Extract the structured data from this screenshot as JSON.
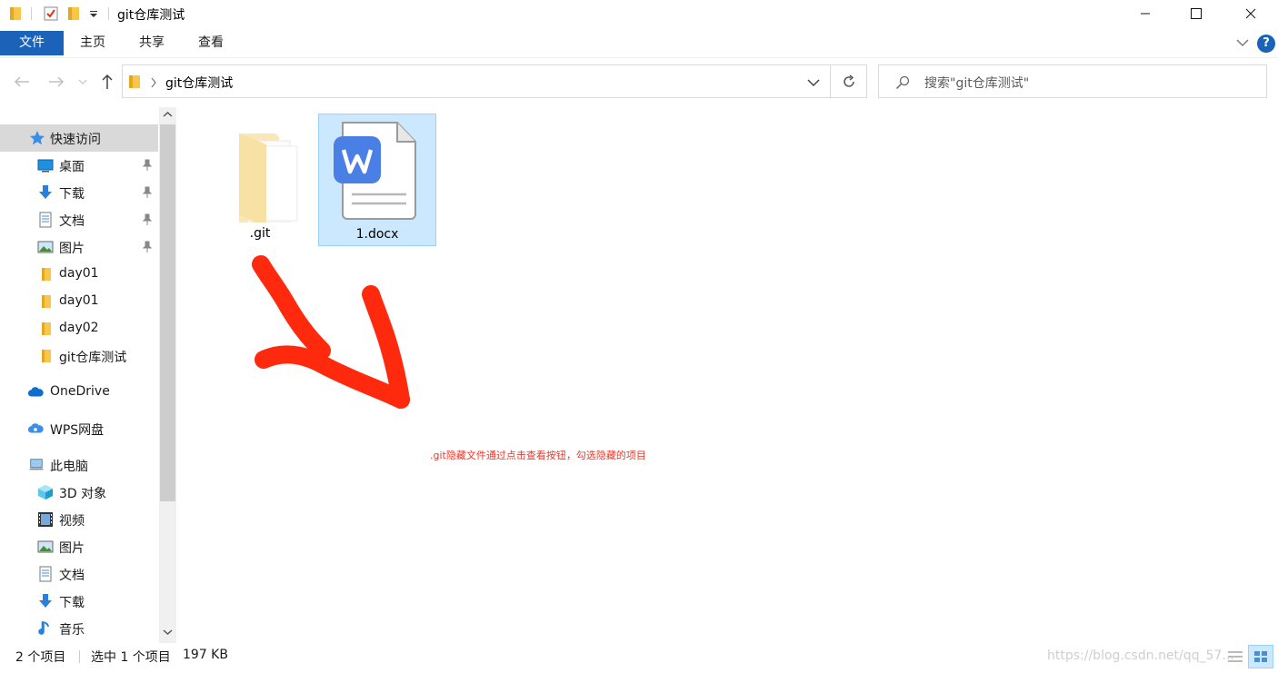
{
  "window": {
    "title": "git仓库测试",
    "controls": [
      "minimize-icon",
      "maximize-icon",
      "close-icon"
    ]
  },
  "ribbon": {
    "tabs": [
      {
        "label": "文件",
        "active": true
      },
      {
        "label": "主页"
      },
      {
        "label": "共享"
      },
      {
        "label": "查看"
      }
    ],
    "help_label": "?"
  },
  "address": {
    "path": "git仓库测试",
    "search_placeholder": "搜索\"git仓库测试\""
  },
  "sidebar": {
    "items": [
      {
        "label": "快速访问",
        "icon": "star-icon",
        "selected": true,
        "pinned": false
      },
      {
        "label": "桌面",
        "icon": "desktop-icon",
        "pinned": true
      },
      {
        "label": "下载",
        "icon": "download-icon",
        "pinned": true
      },
      {
        "label": "文档",
        "icon": "document-icon",
        "pinned": true
      },
      {
        "label": "图片",
        "icon": "pictures-icon",
        "pinned": true
      },
      {
        "label": "day01",
        "icon": "folder-icon"
      },
      {
        "label": "day01",
        "icon": "folder-icon"
      },
      {
        "label": "day02",
        "icon": "folder-icon"
      },
      {
        "label": "git仓库测试",
        "icon": "folder-icon"
      },
      {
        "label": "OneDrive",
        "icon": "cloud-icon"
      },
      {
        "label": "WPS网盘",
        "icon": "cloud-icon"
      },
      {
        "label": "此电脑",
        "icon": "computer-icon"
      },
      {
        "label": "3D 对象",
        "icon": "cube-icon"
      },
      {
        "label": "视频",
        "icon": "video-icon"
      },
      {
        "label": "图片",
        "icon": "pictures-icon"
      },
      {
        "label": "文档",
        "icon": "document-icon"
      },
      {
        "label": "下载",
        "icon": "download-icon"
      },
      {
        "label": "音乐",
        "icon": "music-icon"
      }
    ]
  },
  "files": [
    {
      "name": ".git",
      "icon": "hidden-folder-icon",
      "selected": false
    },
    {
      "name": "1.docx",
      "icon": "wps-docx-icon",
      "selected": true
    }
  ],
  "annotation": {
    "note": ".git隐藏文件通过点击查看按钮，勾选隐藏的项目",
    "color": "#ff2a0e"
  },
  "status": {
    "count": "2 个项目",
    "selection": "选中 1 个项目",
    "size": "197 KB",
    "watermark": "https://blog.csdn.net/qq_57..."
  },
  "colors": {
    "accent": "#1a63b8",
    "selection_bg": "#cce8ff",
    "selection_border": "#99d1ff"
  }
}
